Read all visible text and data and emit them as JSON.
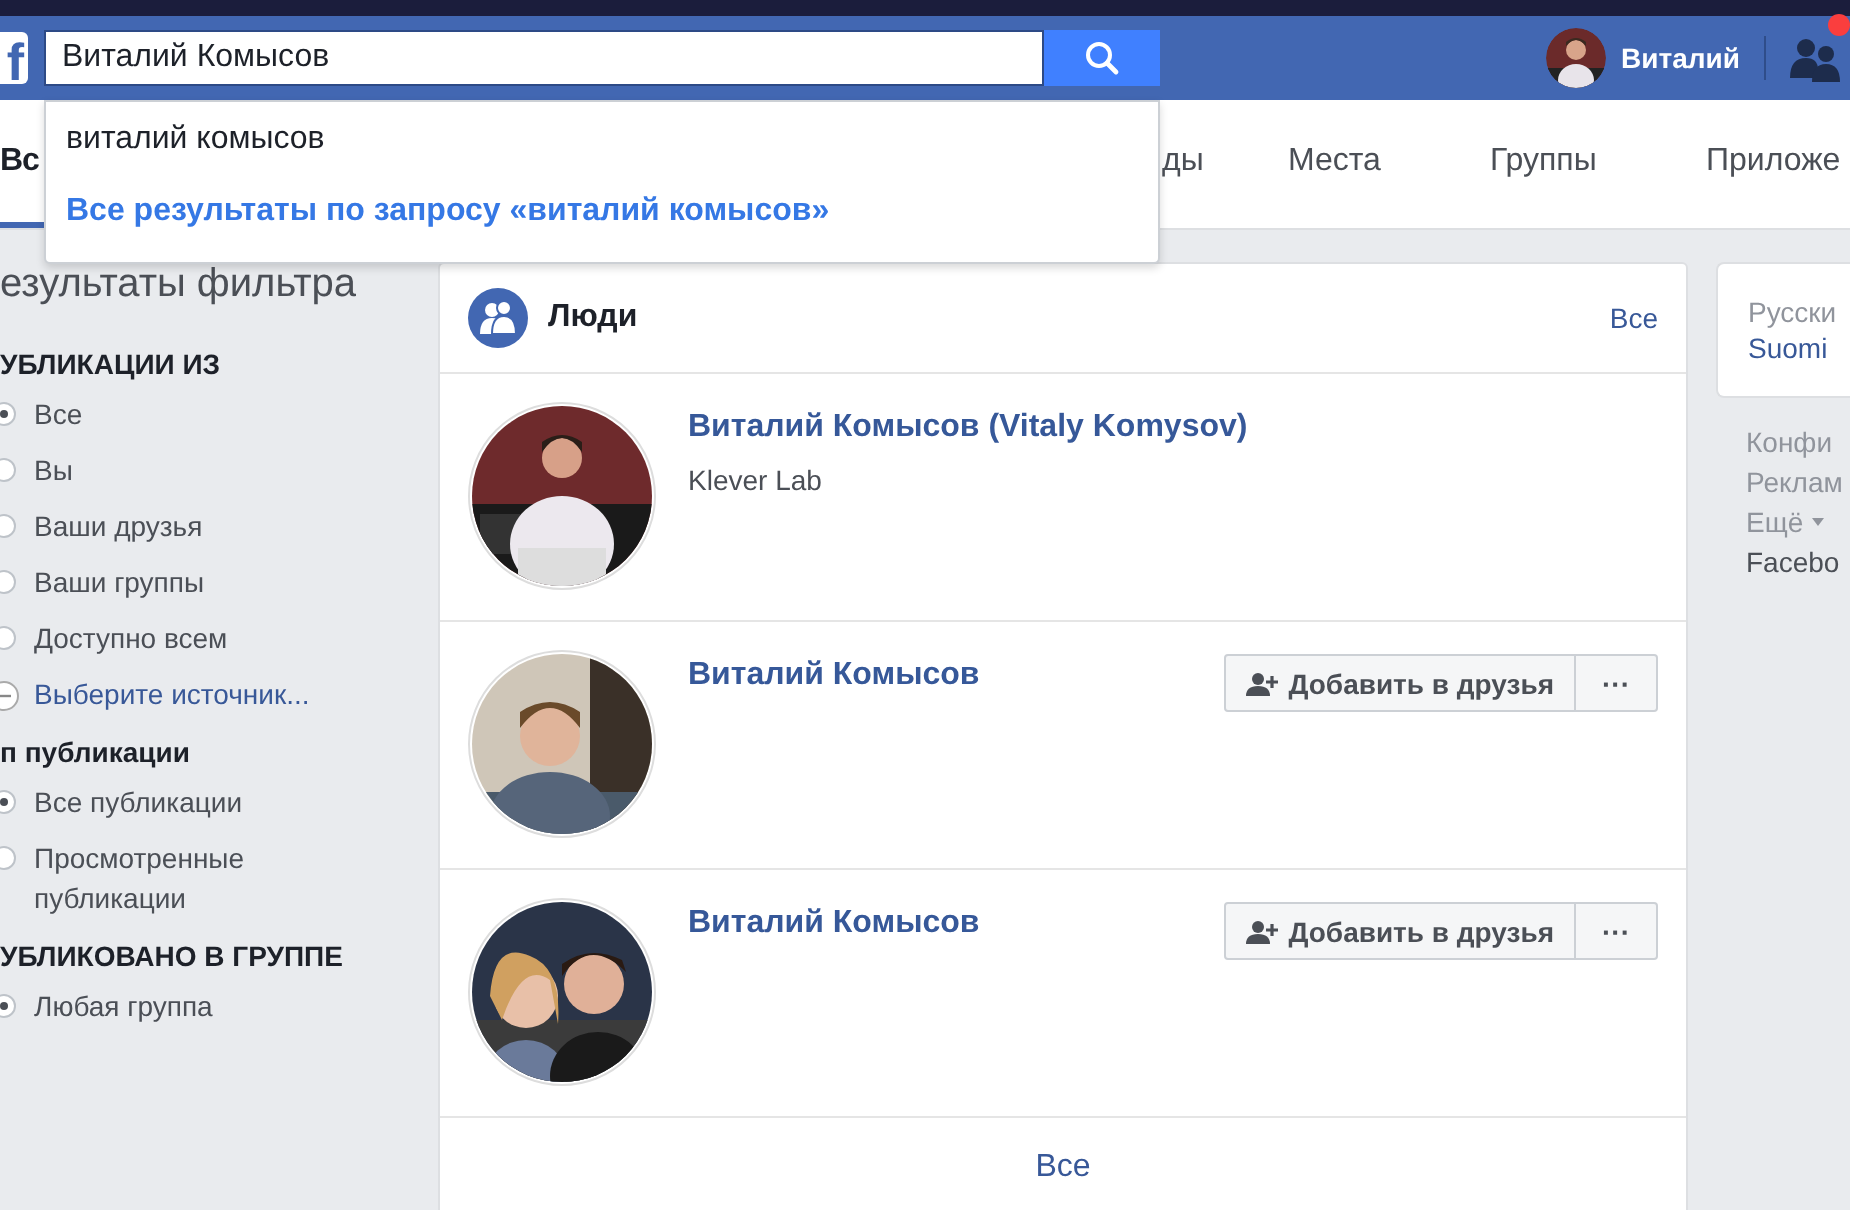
{
  "topbar": {
    "logo": "f",
    "search": {
      "value": "Виталий Комысов"
    },
    "user": {
      "name": "Виталий"
    },
    "friend_requests": {
      "unread": true
    }
  },
  "tabs": [
    {
      "label": "Вс",
      "selected": true
    },
    {
      "label": "ды",
      "selected": false
    },
    {
      "label": "Места",
      "selected": false
    },
    {
      "label": "Группы",
      "selected": false
    },
    {
      "label": "Приложе",
      "selected": false
    }
  ],
  "suggestions": {
    "query": "виталий комысов",
    "all_results": "Все результаты по запросу «виталий комысов»"
  },
  "sidebar": {
    "title": "езультаты фильтра",
    "groups": [
      {
        "heading": "УБЛИКАЦИИ ИЗ",
        "options": [
          {
            "label": "Все",
            "selected": true,
            "kind": "radio"
          },
          {
            "label": "Вы",
            "selected": false,
            "kind": "radio"
          },
          {
            "label": "Ваши друзья",
            "selected": false,
            "kind": "radio"
          },
          {
            "label": "Ваши группы",
            "selected": false,
            "kind": "radio"
          },
          {
            "label": "Доступно всем",
            "selected": false,
            "kind": "radio"
          },
          {
            "label": "Выберите источник...",
            "selected": false,
            "kind": "picker"
          }
        ]
      },
      {
        "heading": "п публикации",
        "options": [
          {
            "label": "Все публикации",
            "selected": true,
            "kind": "radio"
          },
          {
            "label": "Просмотренные публикации",
            "selected": false,
            "kind": "radio"
          }
        ]
      },
      {
        "heading": "УБЛИКОВАНО В ГРУППЕ",
        "options": [
          {
            "label": "Любая группа",
            "selected": true,
            "kind": "radio"
          }
        ]
      }
    ]
  },
  "people": {
    "title": "Люди",
    "see_all": "Все",
    "results": [
      {
        "name": "Виталий Комысов (Vitaly Komysov)",
        "subtitle": "Klever Lab"
      },
      {
        "name": "Виталий Комысов",
        "add_button": "Добавить в друзья",
        "more": "···"
      },
      {
        "name": "Виталий Комысов",
        "add_button": "Добавить в друзья",
        "more": "···"
      }
    ],
    "footer_link": "Все"
  },
  "languages": [
    "Русски",
    "Suomi"
  ],
  "footer_links": [
    {
      "label": "Конфи",
      "kind": "link"
    },
    {
      "label": "Реклам",
      "kind": "link"
    },
    {
      "label": "Ещё",
      "kind": "menu"
    },
    {
      "label": "Facebo",
      "kind": "text"
    }
  ]
}
